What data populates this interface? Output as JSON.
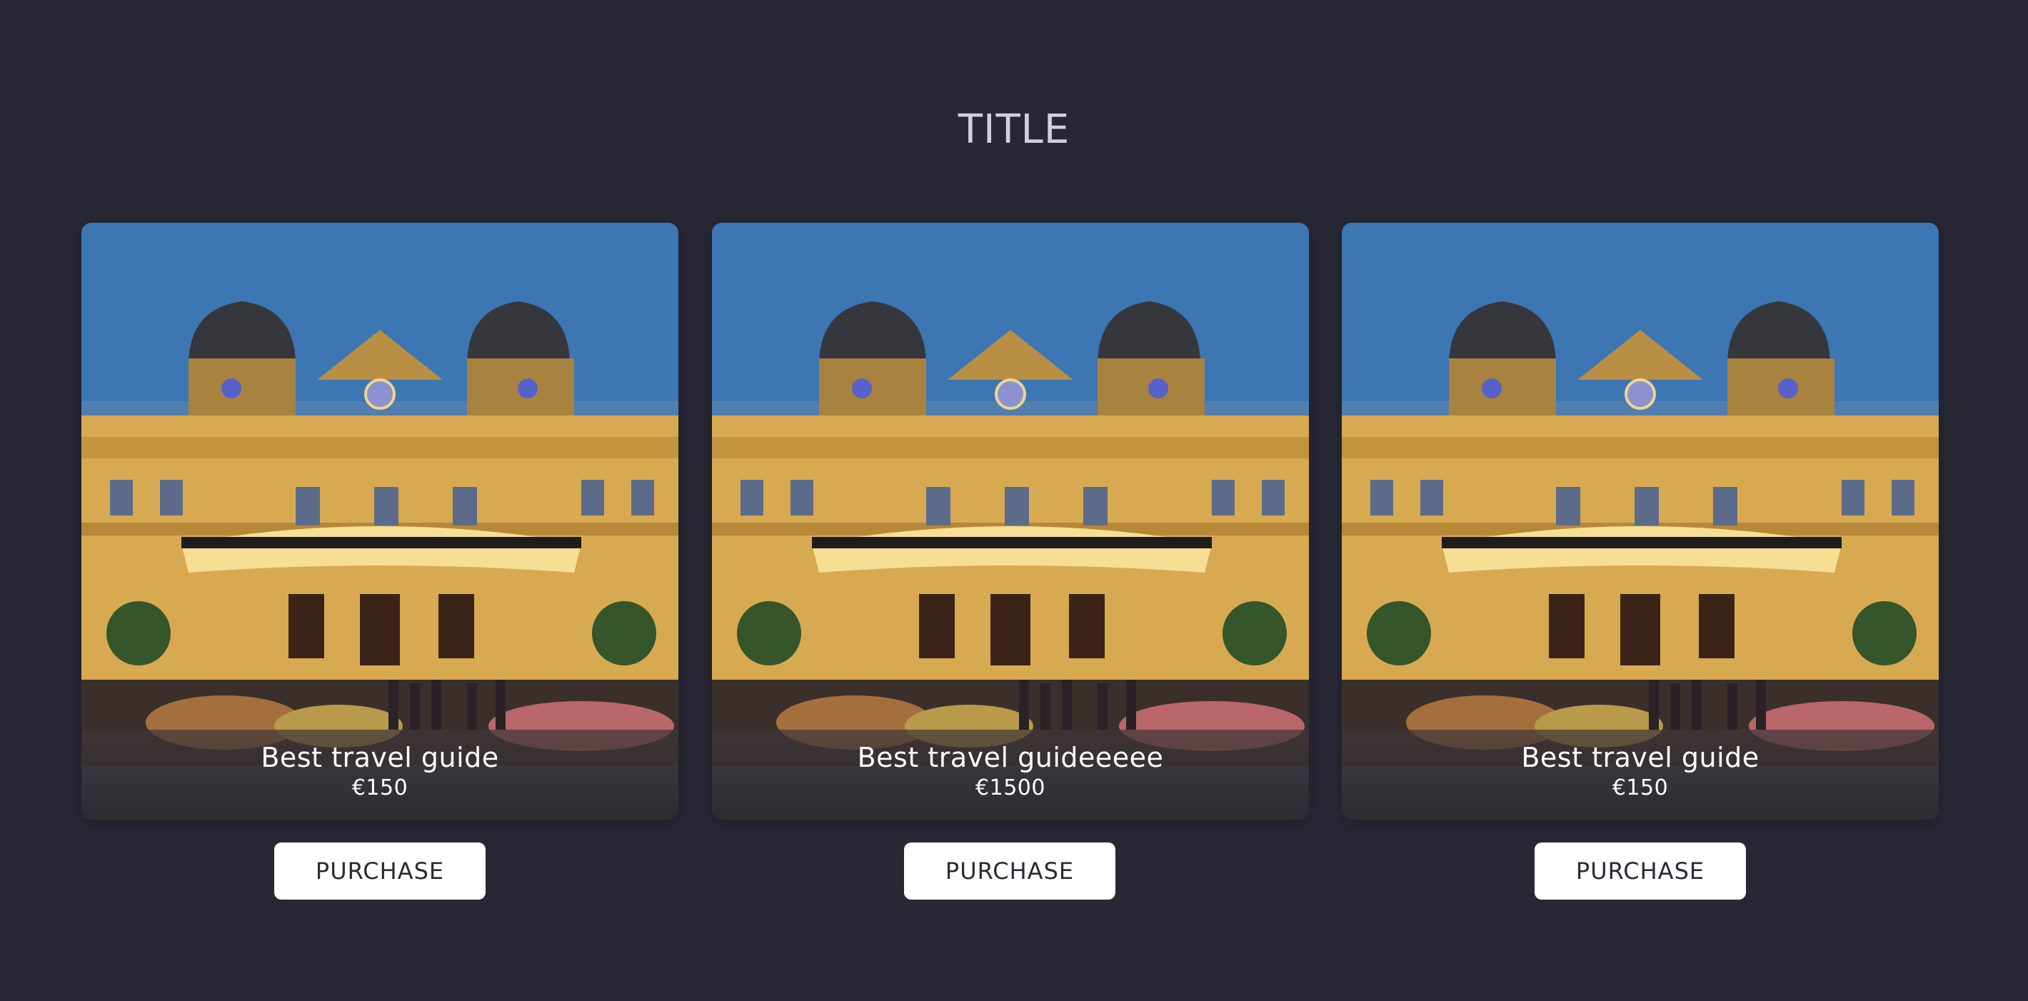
{
  "page": {
    "title": "TITLE"
  },
  "products": [
    {
      "name": "Best travel guide",
      "price": "€150",
      "button_label": "PURCHASE",
      "image": "casino-building-photo"
    },
    {
      "name": "Best travel guideeeee",
      "price": "€1500",
      "button_label": "PURCHASE",
      "image": "casino-building-photo"
    },
    {
      "name": "Best travel guide",
      "price": "€150",
      "button_label": "PURCHASE",
      "image": "casino-building-photo"
    }
  ],
  "colors": {
    "background": "#272834",
    "title": "#cfd1dc",
    "button_bg": "#ffffff",
    "button_text": "#2a2b36",
    "caption_text": "#ffffff"
  }
}
